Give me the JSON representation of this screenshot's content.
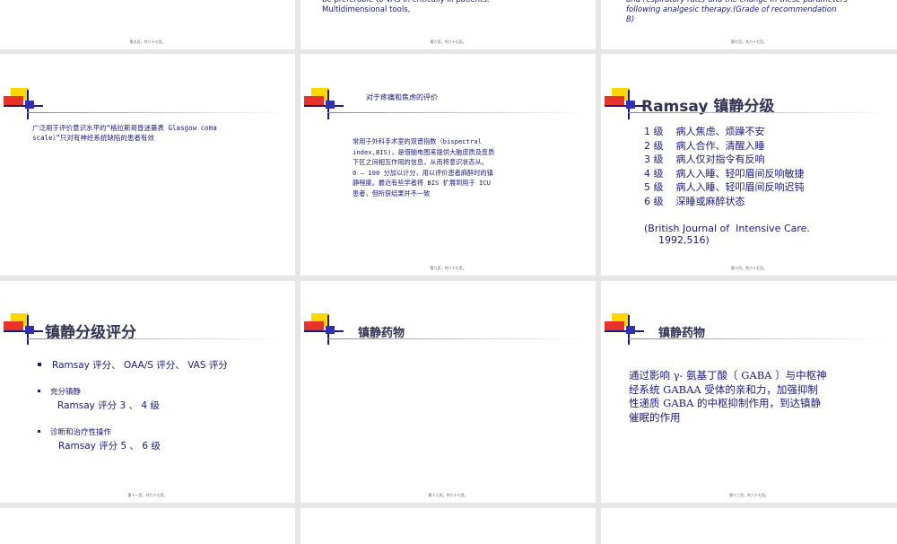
{
  "slides_top": {
    "left_footer": "第五页，共六十七页。",
    "mid_text": "be preferable to VAS in critically ill patients.\nMultidimensional tools,",
    "mid_footer": "第六页，共六十七页。",
    "right_text": "and respiratory rate) and the change in these parameters\nfollowing analgesic therapy.(Grade of recommendation\nB)",
    "right_footer": "第七页，共六十七页。"
  },
  "slide_glasgow": {
    "text": "广泛用于评价意识水平的“格拉斯哥昏迷量表 Glasgow coma\nscale）”只对有神经系统缺陷的患者有效"
  },
  "slide_bis": {
    "title": "对于疼痛和焦虑的评价",
    "text": "常用于外科手术室的双谱指数（bispectral\nindex,BIS)，是借脑电图来提供大脑皮质及皮质\n下区之间相互作用的信息，从而将意识状态从。\n0 — 100 分加以计分，用以评价患者麻醉时的镇\n静程度。最近有些学者将 BIS 扩展到用于 ICU\n患者，但所获结果并不一致",
    "footer": "第九页，共六十七页。"
  },
  "slide_ramsay": {
    "title": "Ramsay 镇静分级",
    "levels": [
      "1 级    病人焦虑、烦躁不安",
      "2 级    病人合作、清醒入睡",
      "3 级    病人仅对指令有反响",
      "4 级    病人入睡、轻叩眉间反响敏捷",
      "5 级    病人入睡、轻叩眉间反响迟钝",
      "6 级    深睡或麻醉状态"
    ],
    "citation_line1": "(British Journal of  Intensive Care.",
    "citation_line2": "1992,516)",
    "footer": "第十页，共六十七页。"
  },
  "slide_sed_scale": {
    "title": "镇静分级评分",
    "bullet1": "Ramsay 评分、 OAA/S 评分、 VAS 评分",
    "bullet2_label": "充分镇静",
    "bullet2_sub": "Ramsay 评分 3 、 4 级",
    "bullet3_label": "诊断和治疗性操作",
    "bullet3_sub": "Ramsay 评分 5 、 6 级",
    "footer": "第十一页，共六十七页。"
  },
  "slide_drugs1": {
    "title": "镇静药物",
    "footer": "第十二页，共六十七页。"
  },
  "slide_drugs2": {
    "title": "镇静药物",
    "text": "通过影响 γ- 氨基丁酸〔 GABA 〕与中枢神\n经系统 GABAA 受体的亲和力，加强抑制\n性递质 GABA 的中枢抑制作用，到达镇静\n催眠的作用",
    "footer": "第十三页，共六十七页。"
  }
}
